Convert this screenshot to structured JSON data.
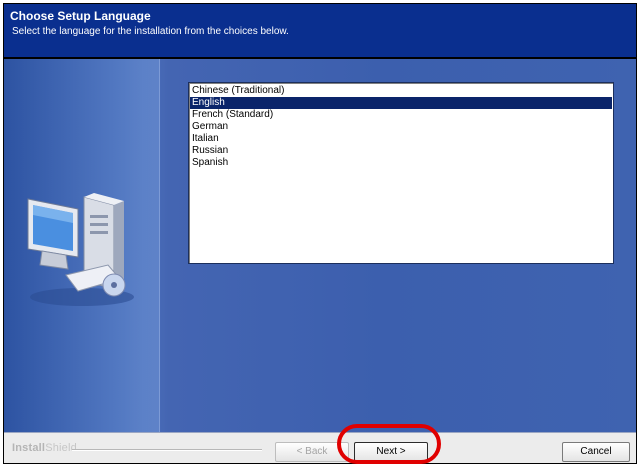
{
  "header": {
    "title": "Choose Setup Language",
    "subtitle": "Select the language for the installation from the choices below."
  },
  "languages": {
    "items": [
      {
        "label": "Chinese (Traditional)",
        "selected": false
      },
      {
        "label": "English",
        "selected": true
      },
      {
        "label": "French (Standard)",
        "selected": false
      },
      {
        "label": "German",
        "selected": false
      },
      {
        "label": "Italian",
        "selected": false
      },
      {
        "label": "Russian",
        "selected": false
      },
      {
        "label": "Spanish",
        "selected": false
      }
    ]
  },
  "footer": {
    "brand_bold": "Install",
    "brand_light": "Shield",
    "back_label": "< Back",
    "next_label": "Next >",
    "cancel_label": "Cancel"
  },
  "colors": {
    "header_bg": "#0a2f8f",
    "body_bg": "#3a5fae",
    "selection": "#0a246a",
    "highlight_ring": "#e00000"
  }
}
